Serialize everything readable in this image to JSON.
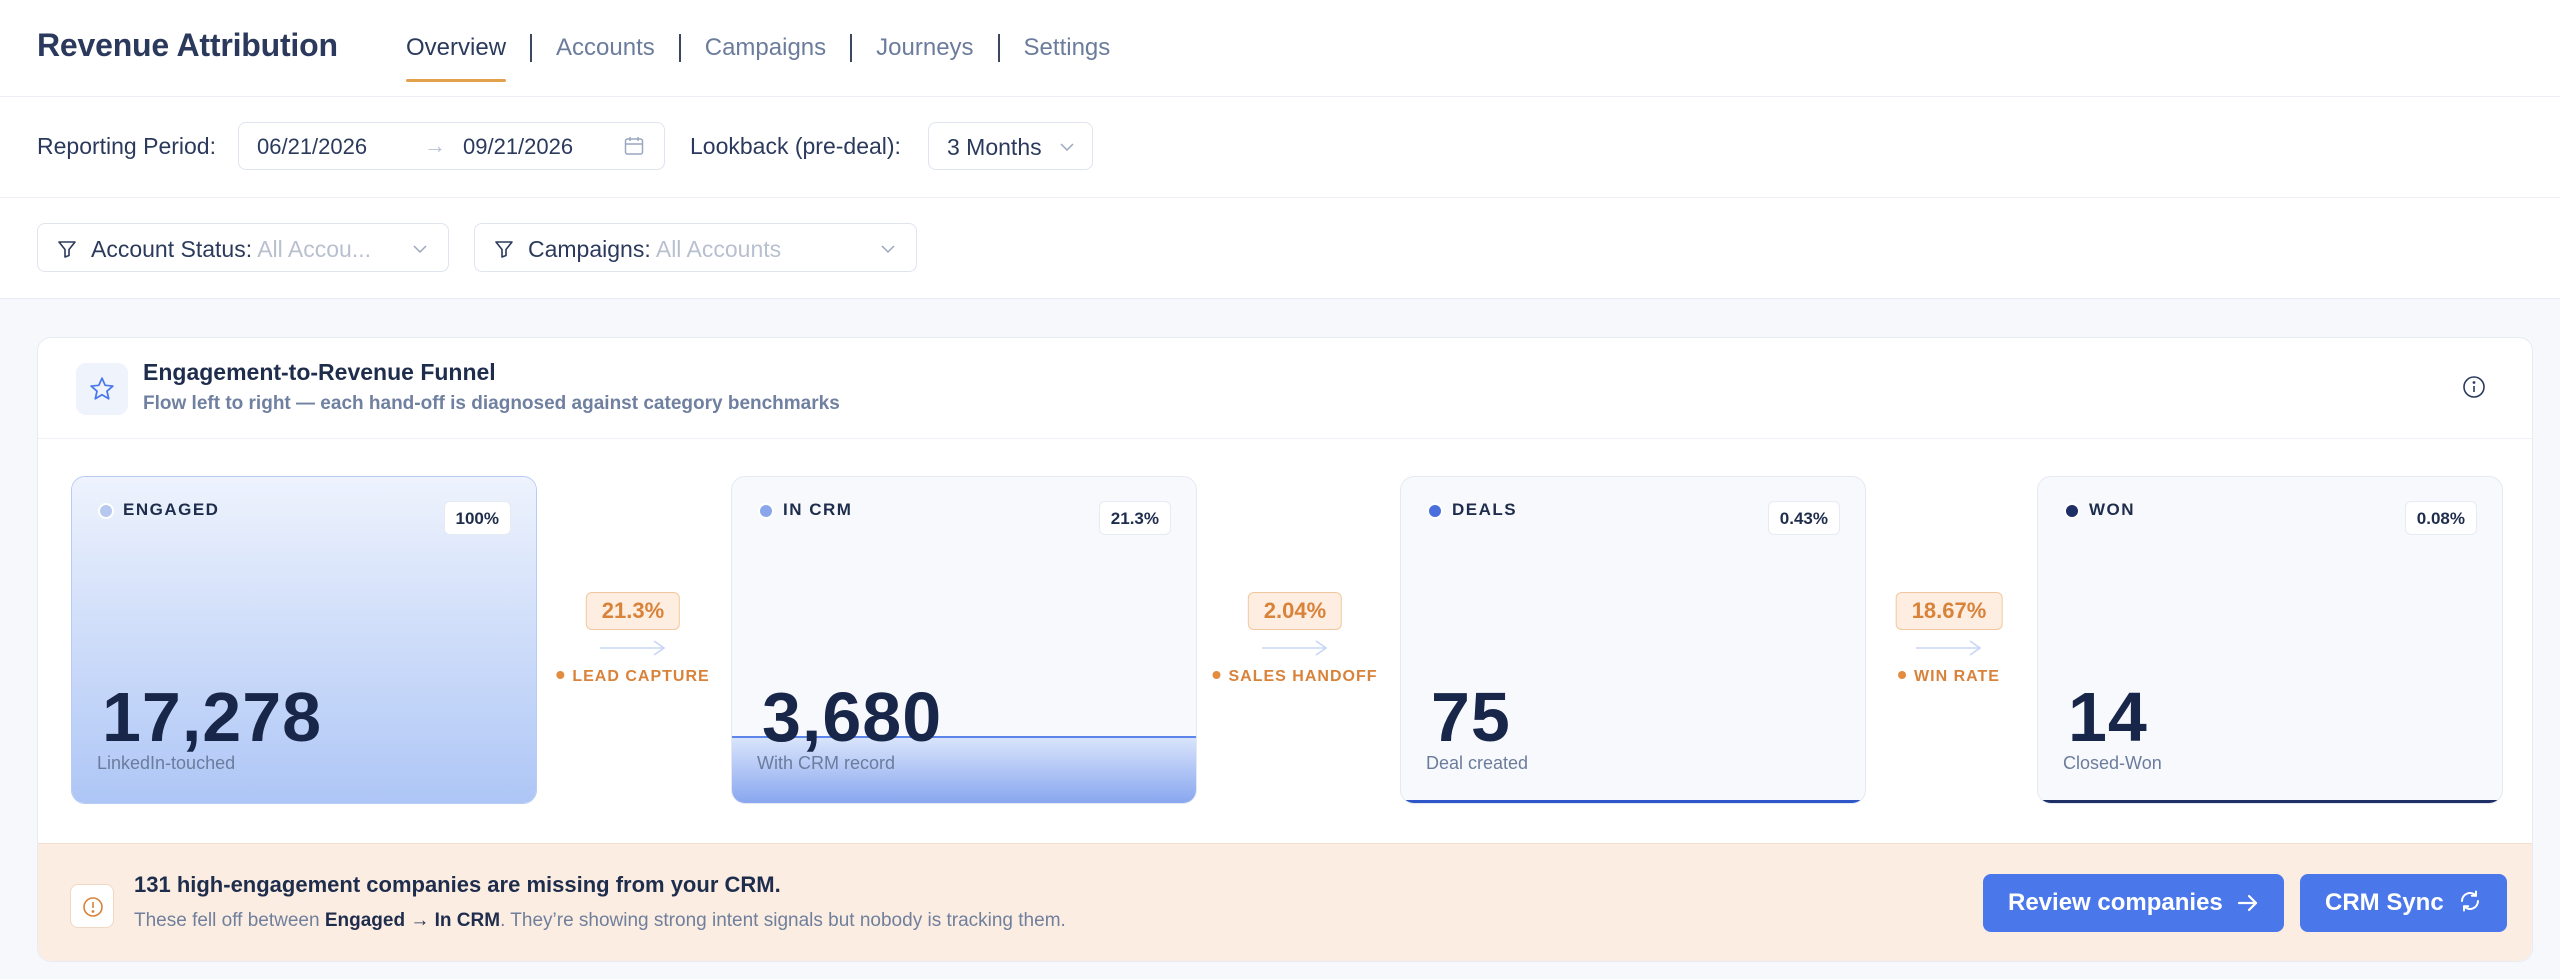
{
  "app": {
    "title": "Revenue Attribution"
  },
  "nav": {
    "tabs": [
      "Overview",
      "Accounts",
      "Campaigns",
      "Journeys",
      "Settings"
    ],
    "active": "Overview"
  },
  "period": {
    "label": "Reporting Period:",
    "start": "06/21/2026",
    "arrow": "→",
    "end": "09/21/2026",
    "lookback_label": "Lookback (pre-deal):",
    "lookback_value": "3 Months"
  },
  "filters": {
    "account_status": {
      "label": "Account Status:",
      "value": "All Accou..."
    },
    "campaigns": {
      "label": "Campaigns:",
      "value": "All Accounts"
    }
  },
  "funnel": {
    "title": "Engagement-to-Revenue Funnel",
    "subtitle": "Flow left to right — each hand-off is diagnosed against category benchmarks",
    "stages": [
      {
        "name": "ENGAGED",
        "pct": "100%",
        "value": "17,278",
        "caption": "LinkedIn-touched",
        "dot_color": "#b7c8ef",
        "fill_fraction": 1.0
      },
      {
        "name": "IN CRM",
        "pct": "21.3%",
        "value": "3,680",
        "caption": "With CRM record",
        "dot_color": "#8aa6ea",
        "fill_fraction": 0.213
      },
      {
        "name": "DEALS",
        "pct": "0.43%",
        "value": "75",
        "caption": "Deal created",
        "dot_color": "#4a6fdc",
        "fill_fraction": 0.0043
      },
      {
        "name": "WON",
        "pct": "0.08%",
        "value": "14",
        "caption": "Closed-Won",
        "dot_color": "#1e2f66",
        "fill_fraction": 0.0008
      }
    ],
    "connectors": [
      {
        "rate": "21.3%",
        "label": "LEAD CAPTURE"
      },
      {
        "rate": "2.04%",
        "label": "SALES HANDOFF"
      },
      {
        "rate": "18.67%",
        "label": "WIN RATE"
      }
    ]
  },
  "alert": {
    "title": "131 high-engagement companies are missing from your CRM.",
    "text_pre": "These fell off between ",
    "from": "Engaged",
    "arrow": " → ",
    "to": "In CRM",
    "text_post": ". They’re showing strong intent signals but nobody is tracking them.",
    "primary_button": "Review companies",
    "secondary_button": "CRM Sync"
  },
  "colors": {
    "accent": "#4a77ea",
    "tab_underline": "#e3a04b",
    "warning": "#d9823a",
    "alert_bg": "#fbede2"
  }
}
